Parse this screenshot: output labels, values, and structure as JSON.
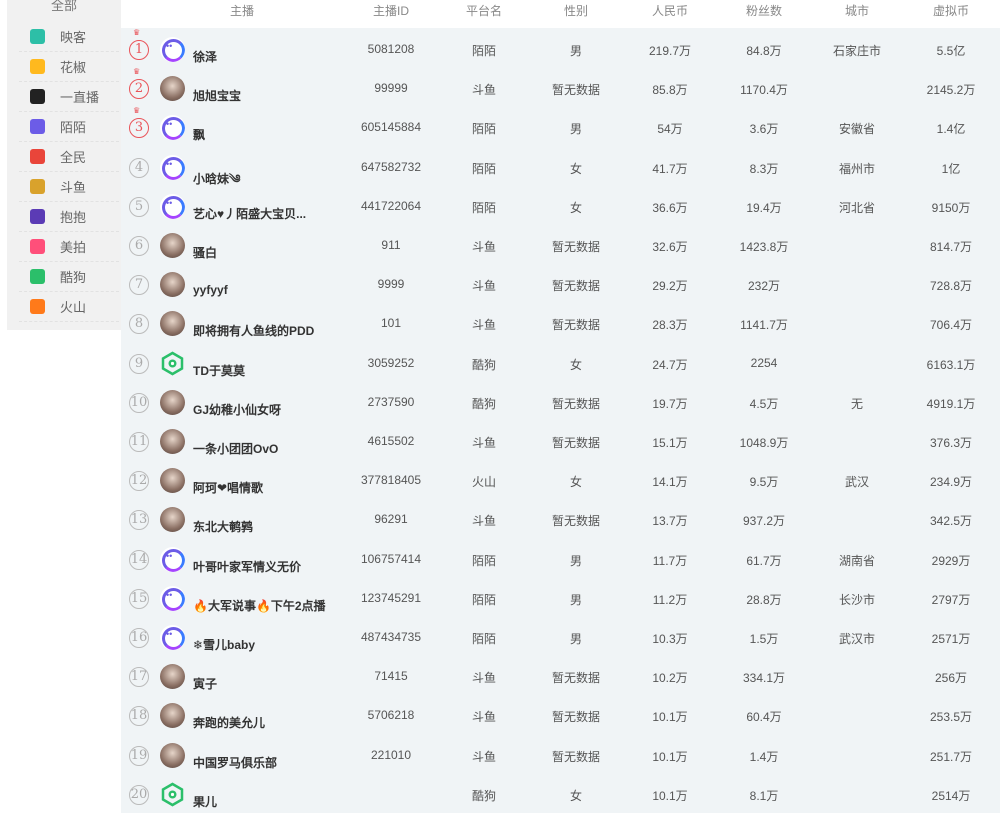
{
  "sidebar": {
    "all_label": "全部",
    "items": [
      {
        "label": "映客",
        "icon": "inke-icon",
        "color": "#2dbfa7"
      },
      {
        "label": "花椒",
        "icon": "huajiao-icon",
        "color": "#ffb91e"
      },
      {
        "label": "一直播",
        "icon": "yizhibo-icon",
        "color": "#222222"
      },
      {
        "label": "陌陌",
        "icon": "momo-icon",
        "color": "#6c5ce7"
      },
      {
        "label": "全民",
        "icon": "quanmin-icon",
        "color": "#e9453a"
      },
      {
        "label": "斗鱼",
        "icon": "douyu-icon",
        "color": "#d9a22c"
      },
      {
        "label": "抱抱",
        "icon": "baobao-icon",
        "color": "#5b3bb5"
      },
      {
        "label": "美拍",
        "icon": "meipai-icon",
        "color": "#ff4f7a"
      },
      {
        "label": "酷狗",
        "icon": "kugou-icon",
        "color": "#2bbf6a"
      },
      {
        "label": "火山",
        "icon": "huoshan-icon",
        "color": "#ff7a1a"
      }
    ]
  },
  "table": {
    "headers": {
      "anchor": "主播",
      "anchor_id": "主播ID",
      "platform": "平台名",
      "gender": "性别",
      "rmb": "人民币",
      "fans": "粉丝数",
      "city": "城市",
      "virtual": "虚拟币"
    },
    "rows": [
      {
        "rank": "1",
        "avatar": "momo",
        "name": "徐泽",
        "id": "5081208",
        "platform": "陌陌",
        "gender": "男",
        "rmb": "219.7万",
        "fans": "84.8万",
        "city": "石家庄市",
        "virtual": "5.5亿"
      },
      {
        "rank": "2",
        "avatar": "photo",
        "name": "旭旭宝宝",
        "id": "99999",
        "platform": "斗鱼",
        "gender": "暂无数据",
        "rmb": "85.8万",
        "fans": "1170.4万",
        "city": "",
        "virtual": "2145.2万"
      },
      {
        "rank": "3",
        "avatar": "momo",
        "name": "飘",
        "id": "605145884",
        "platform": "陌陌",
        "gender": "男",
        "rmb": "54万",
        "fans": "3.6万",
        "city": "安徽省",
        "virtual": "1.4亿"
      },
      {
        "rank": "4",
        "avatar": "momo",
        "name": "小晗妹༄",
        "id": "647582732",
        "platform": "陌陌",
        "gender": "女",
        "rmb": "41.7万",
        "fans": "8.3万",
        "city": "福州市",
        "virtual": "1亿"
      },
      {
        "rank": "5",
        "avatar": "momo",
        "name": "艺心♥丿陌盛大宝贝...",
        "id": "441722064",
        "platform": "陌陌",
        "gender": "女",
        "rmb": "36.6万",
        "fans": "19.4万",
        "city": "河北省",
        "virtual": "9150万"
      },
      {
        "rank": "6",
        "avatar": "photo",
        "name": "骚白",
        "id": "911",
        "platform": "斗鱼",
        "gender": "暂无数据",
        "rmb": "32.6万",
        "fans": "1423.8万",
        "city": "",
        "virtual": "814.7万"
      },
      {
        "rank": "7",
        "avatar": "photo",
        "name": "yyfyyf",
        "id": "9999",
        "platform": "斗鱼",
        "gender": "暂无数据",
        "rmb": "29.2万",
        "fans": "232万",
        "city": "",
        "virtual": "728.8万"
      },
      {
        "rank": "8",
        "avatar": "photo",
        "name": "即将拥有人鱼线的PDD",
        "id": "101",
        "platform": "斗鱼",
        "gender": "暂无数据",
        "rmb": "28.3万",
        "fans": "1141.7万",
        "city": "",
        "virtual": "706.4万"
      },
      {
        "rank": "9",
        "avatar": "kugou",
        "name": "TD于莫莫",
        "id": "3059252",
        "platform": "酷狗",
        "gender": "女",
        "rmb": "24.7万",
        "fans": "2254",
        "city": "",
        "virtual": "6163.1万"
      },
      {
        "rank": "10",
        "avatar": "photo",
        "name": "GJ幼稚小仙女呀",
        "id": "2737590",
        "platform": "酷狗",
        "gender": "暂无数据",
        "rmb": "19.7万",
        "fans": "4.5万",
        "city": "无",
        "virtual": "4919.1万"
      },
      {
        "rank": "11",
        "avatar": "photo",
        "name": "一条小团团OvO",
        "id": "4615502",
        "platform": "斗鱼",
        "gender": "暂无数据",
        "rmb": "15.1万",
        "fans": "1048.9万",
        "city": "",
        "virtual": "376.3万"
      },
      {
        "rank": "12",
        "avatar": "photo",
        "name": "阿珂❤唱情歌",
        "id": "377818405",
        "platform": "火山",
        "gender": "女",
        "rmb": "14.1万",
        "fans": "9.5万",
        "city": "武汉",
        "virtual": "234.9万"
      },
      {
        "rank": "13",
        "avatar": "photo",
        "name": "东北大鹌鹑",
        "id": "96291",
        "platform": "斗鱼",
        "gender": "暂无数据",
        "rmb": "13.7万",
        "fans": "937.2万",
        "city": "",
        "virtual": "342.5万"
      },
      {
        "rank": "14",
        "avatar": "momo",
        "name": "叶哥叶家军情义无价",
        "id": "106757414",
        "platform": "陌陌",
        "gender": "男",
        "rmb": "11.7万",
        "fans": "61.7万",
        "city": "湖南省",
        "virtual": "2929万"
      },
      {
        "rank": "15",
        "avatar": "momo",
        "name": "🔥大军说事🔥下午2点播",
        "id": "123745291",
        "platform": "陌陌",
        "gender": "男",
        "rmb": "11.2万",
        "fans": "28.8万",
        "city": "长沙市",
        "virtual": "2797万"
      },
      {
        "rank": "16",
        "avatar": "momo",
        "name": "❄雪儿baby",
        "id": "487434735",
        "platform": "陌陌",
        "gender": "男",
        "rmb": "10.3万",
        "fans": "1.5万",
        "city": "武汉市",
        "virtual": "2571万"
      },
      {
        "rank": "17",
        "avatar": "photo",
        "name": "寅子",
        "id": "71415",
        "platform": "斗鱼",
        "gender": "暂无数据",
        "rmb": "10.2万",
        "fans": "334.1万",
        "city": "",
        "virtual": "256万"
      },
      {
        "rank": "18",
        "avatar": "photo",
        "name": "奔跑的美允儿",
        "id": "5706218",
        "platform": "斗鱼",
        "gender": "暂无数据",
        "rmb": "10.1万",
        "fans": "60.4万",
        "city": "",
        "virtual": "253.5万"
      },
      {
        "rank": "19",
        "avatar": "photo",
        "name": "中国罗马俱乐部",
        "id": "221010",
        "platform": "斗鱼",
        "gender": "暂无数据",
        "rmb": "10.1万",
        "fans": "1.4万",
        "city": "",
        "virtual": "251.7万"
      },
      {
        "rank": "20",
        "avatar": "kugou",
        "name": "果儿",
        "id": "",
        "platform": "酷狗",
        "gender": "女",
        "rmb": "10.1万",
        "fans": "8.1万",
        "city": "",
        "virtual": "2514万"
      }
    ]
  },
  "colors": {
    "rank_top": "#e9545a",
    "table_bg": "#f0f4f6",
    "sidebar_bg": "#f1f1f1",
    "momo_purple": "#6c5ce7",
    "kugou_green": "#2bbf6a"
  }
}
